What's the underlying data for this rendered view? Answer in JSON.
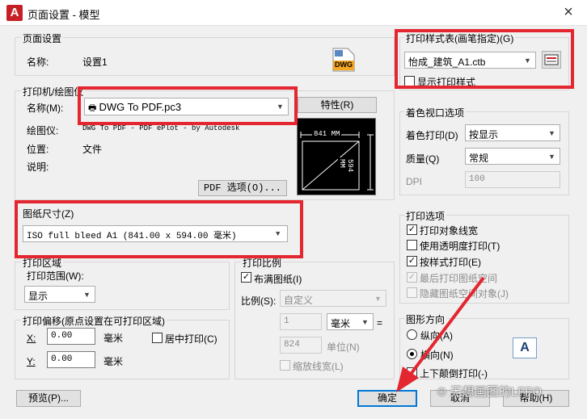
{
  "window": {
    "title": "页面设置 - 模型",
    "app_icon": "A",
    "close": "×"
  },
  "page_setup": {
    "legend": "页面设置",
    "name_label": "名称:",
    "name_value": "设置1",
    "dwg_badge": "DWG"
  },
  "printer": {
    "legend": "打印机/绘图仪",
    "name_label": "名称(M):",
    "name_value": "DWG To PDF.pc3",
    "properties_btn": "特性(R)",
    "plotter_label": "绘图仪:",
    "plotter_value": "DWG To PDF - PDF ePlot - by Autodesk",
    "location_label": "位置:",
    "location_value": "文件",
    "desc_label": "说明:",
    "pdf_options_btn": "PDF 选项(O)...",
    "preview_width": "841 MM",
    "preview_height": "594 MM"
  },
  "paper_size": {
    "legend": "图纸尺寸(Z)",
    "value": "ISO full bleed A1 (841.00 x 594.00 毫米)"
  },
  "plot_area": {
    "legend": "打印区域",
    "range_label": "打印范围(W):",
    "range_value": "显示"
  },
  "plot_offset": {
    "legend": "打印偏移(原点设置在可打印区域)",
    "x_label": "X:",
    "x_value": "0.00",
    "x_unit": "毫米",
    "y_label": "Y:",
    "y_value": "0.00",
    "y_unit": "毫米",
    "center_label": "居中打印(C)"
  },
  "plot_scale": {
    "legend": "打印比例",
    "fit_label": "布满图纸(I)",
    "scale_label": "比例(S):",
    "scale_value": "自定义",
    "num_value": "1",
    "num_unit": "毫米",
    "equals": "=",
    "den_value": "824",
    "den_unit": "单位(N)",
    "lineweight_label": "缩放线宽(L)"
  },
  "style_table": {
    "legend": "打印样式表(画笔指定)(G)",
    "value": "怡成_建筑_A1.ctb",
    "show_styles_label": "显示打印样式"
  },
  "shaded_viewport": {
    "legend": "着色视口选项",
    "shade_label": "着色打印(D)",
    "shade_value": "按显示",
    "quality_label": "质量(Q)",
    "quality_value": "常规",
    "dpi_label": "DPI",
    "dpi_value": "100"
  },
  "plot_options": {
    "legend": "打印选项",
    "items": [
      {
        "label": "打印对象线宽",
        "checked": "✓"
      },
      {
        "label": "使用透明度打印(T)",
        "checked": ""
      },
      {
        "label": "按样式打印(E)",
        "checked": "✓"
      },
      {
        "label": "最后打印图纸空间",
        "checked": "✓"
      },
      {
        "label": "隐藏图纸空间对象(J)",
        "checked": ""
      }
    ]
  },
  "orientation": {
    "legend": "图形方向",
    "portrait_label": "纵向(A)",
    "landscape_label": "横向(N)",
    "upside_label": "上下颠倒打印(-)",
    "icon_letter": "A"
  },
  "footer": {
    "preview_btn": "预览(P)...",
    "ok_btn": "确定",
    "cancel_btn": "取消",
    "help_btn": "帮助(H)"
  },
  "watermark": {
    "text": "无想画图的LFFO"
  },
  "colors": {
    "highlight": "#e3262f",
    "accent": "#0078d7",
    "dwg": "#f5a623"
  }
}
